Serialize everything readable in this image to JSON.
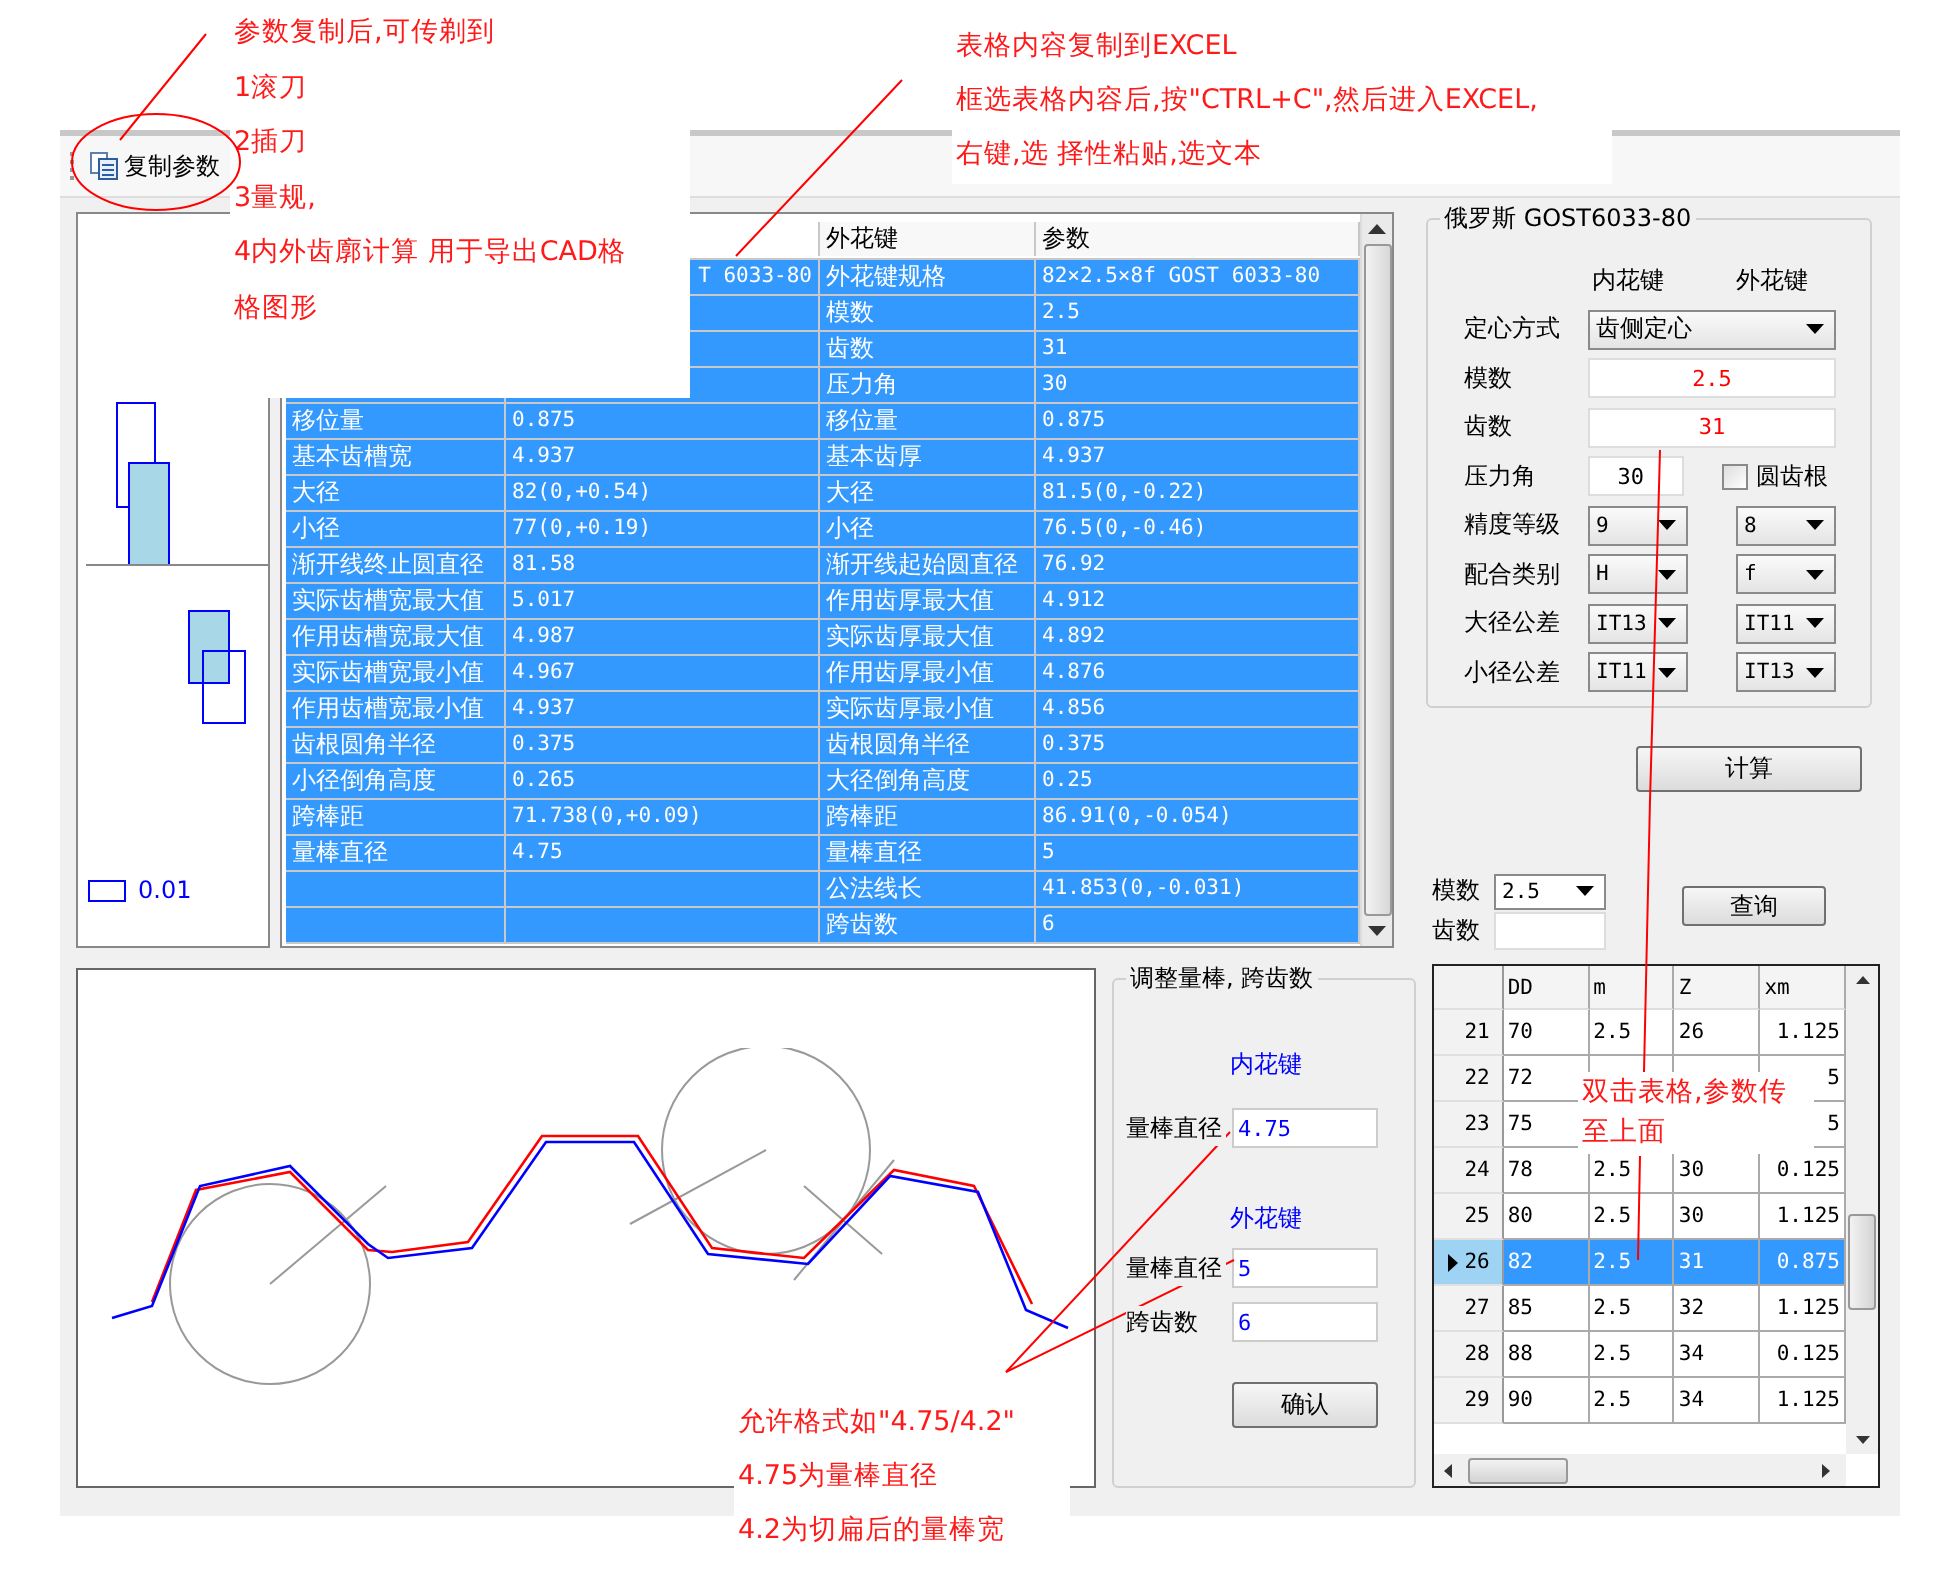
{
  "annotations": [
    {
      "lines": [
        "参数复制后,可传剃到",
        "1滚刀",
        "2插刀",
        "3量规,",
        "4内外齿廓计算 用于导出CAD格",
        "格图形"
      ]
    },
    {
      "lines": [
        "表格内容复制到EXCEL",
        "框选表格内容后,按\"CTRL+C\",然后进入EXCEL,",
        "右键,选 择性粘贴,选文本"
      ]
    },
    {
      "lines": [
        "双击表格,参数传",
        "至上面"
      ]
    },
    {
      "lines": [
        "允许格式如\"4.75/4.2\"",
        "4.75为量棒直径",
        "4.2为切扁后的量棒宽"
      ]
    }
  ],
  "toolbar": {
    "copy_button": "复制参数"
  },
  "tolerance_legend": "0.01",
  "parameter_table": {
    "header": {
      "outer_name": "外花键",
      "outer_value": "参数"
    },
    "rows": [
      {
        "inner_value": "T 6033-80",
        "outer_name": "外花键规格",
        "outer_value": "82×2.5×8f GOST 6033-80",
        "selected": true
      },
      {
        "outer_name": "模数",
        "outer_value": "2.5",
        "selected": true
      },
      {
        "outer_name": "齿数",
        "outer_value": "31",
        "selected": true
      },
      {
        "outer_name": "压力角",
        "outer_value": "30",
        "selected": true
      },
      {
        "inner_name": "移位量",
        "inner_value": "0.875",
        "outer_name": "移位量",
        "outer_value": "0.875",
        "selected": true
      },
      {
        "inner_name": "基本齿槽宽",
        "inner_value": "4.937",
        "outer_name": "基本齿厚",
        "outer_value": "4.937",
        "selected": true
      },
      {
        "inner_name": "大径",
        "inner_value": "82(0,+0.54)",
        "outer_name": "大径",
        "outer_value": "81.5(0,-0.22)",
        "selected": true
      },
      {
        "inner_name": "小径",
        "inner_value": "77(0,+0.19)",
        "outer_name": "小径",
        "outer_value": "76.5(0,-0.46)",
        "selected": true
      },
      {
        "inner_name": "渐开线终止圆直径",
        "inner_value": "81.58",
        "outer_name": "渐开线起始圆直径",
        "outer_value": "76.92",
        "selected": true
      },
      {
        "inner_name": "实际齿槽宽最大值",
        "inner_value": "5.017",
        "outer_name": "作用齿厚最大值",
        "outer_value": "4.912",
        "selected": true
      },
      {
        "inner_name": "作用齿槽宽最大值",
        "inner_value": "4.987",
        "outer_name": "实际齿厚最大值",
        "outer_value": "4.892",
        "selected": true
      },
      {
        "inner_name": "实际齿槽宽最小值",
        "inner_value": "4.967",
        "outer_name": "作用齿厚最小值",
        "outer_value": "4.876",
        "selected": true
      },
      {
        "inner_name": "作用齿槽宽最小值",
        "inner_value": "4.937",
        "outer_name": "实际齿厚最小值",
        "outer_value": "4.856",
        "selected": true
      },
      {
        "inner_name": "齿根圆角半径",
        "inner_value": "0.375",
        "outer_name": "齿根圆角半径",
        "outer_value": "0.375",
        "selected": true
      },
      {
        "inner_name": "小径倒角高度",
        "inner_value": "0.265",
        "outer_name": "大径倒角高度",
        "outer_value": "0.25",
        "selected": true
      },
      {
        "inner_name": "跨棒距",
        "inner_value": "71.738(0,+0.09)",
        "outer_name": "跨棒距",
        "outer_value": "86.91(0,-0.054)",
        "selected": true
      },
      {
        "inner_name": "量棒直径",
        "inner_value": "4.75",
        "outer_name": "量棒直径",
        "outer_value": "5",
        "selected": true
      },
      {
        "outer_name": "公法线长",
        "outer_value": "41.853(0,-0.031)",
        "selected": true
      },
      {
        "outer_name": "跨齿数",
        "outer_value": "6",
        "selected": true
      }
    ]
  },
  "standard_group": {
    "title": "俄罗斯 GOST6033-80",
    "column_headers": [
      "内花键",
      "外花键"
    ],
    "centering": {
      "label": "定心方式",
      "value": "齿侧定心"
    },
    "module": {
      "label": "模数",
      "value": "2.5"
    },
    "teeth": {
      "label": "齿数",
      "value": "31"
    },
    "pressure_angle": {
      "label": "压力角",
      "value": "30"
    },
    "round_root": {
      "label": "圆齿根",
      "checked": false
    },
    "selects": [
      {
        "label": "精度等级",
        "inner": "9",
        "outer": "8"
      },
      {
        "label": "配合类别",
        "inner": "H",
        "outer": "f"
      },
      {
        "label": "大径公差",
        "inner": "IT13",
        "outer": "IT11"
      },
      {
        "label": "小径公差",
        "inner": "IT11",
        "outer": "IT13"
      }
    ]
  },
  "calculate_button": "计算",
  "lookup": {
    "module_label": "模数",
    "module_value": "2.5",
    "teeth_label": "齿数",
    "query_button": "查询"
  },
  "size_grid": {
    "columns": [
      "DD",
      "m",
      "Z",
      "xm"
    ],
    "rows": [
      {
        "index": "21",
        "cells": [
          "70",
          "2.5",
          "26",
          "1.125"
        ],
        "selected": false
      },
      {
        "index": "22",
        "cells": [
          "72",
          null,
          null,
          "5"
        ],
        "selected": false
      },
      {
        "index": "23",
        "cells": [
          "75",
          null,
          null,
          "5"
        ],
        "selected": false
      },
      {
        "index": "24",
        "cells": [
          "78",
          "2.5",
          "30",
          "0.125"
        ],
        "selected": false
      },
      {
        "index": "25",
        "cells": [
          "80",
          "2.5",
          "30",
          "1.125"
        ],
        "selected": false
      },
      {
        "index": "26",
        "cells": [
          "82",
          "2.5",
          "31",
          "0.875"
        ],
        "selected": true
      },
      {
        "index": "27",
        "cells": [
          "85",
          "2.5",
          "32",
          "1.125"
        ],
        "selected": false
      },
      {
        "index": "28",
        "cells": [
          "88",
          "2.5",
          "34",
          "0.125"
        ],
        "selected": false
      },
      {
        "index": "29",
        "cells": [
          "90",
          "2.5",
          "34",
          "1.125"
        ],
        "selected": false
      }
    ]
  },
  "pin_group": {
    "title": "调整量棒, 跨齿数",
    "inner_title": "内花键",
    "inner_pin_label": "量棒直径",
    "inner_pin_value": "4.75",
    "outer_title": "外花键",
    "outer_pin_label": "量棒直径",
    "outer_pin_value": "5",
    "span_label": "跨齿数",
    "span_value": "6",
    "confirm_button": "确认"
  }
}
